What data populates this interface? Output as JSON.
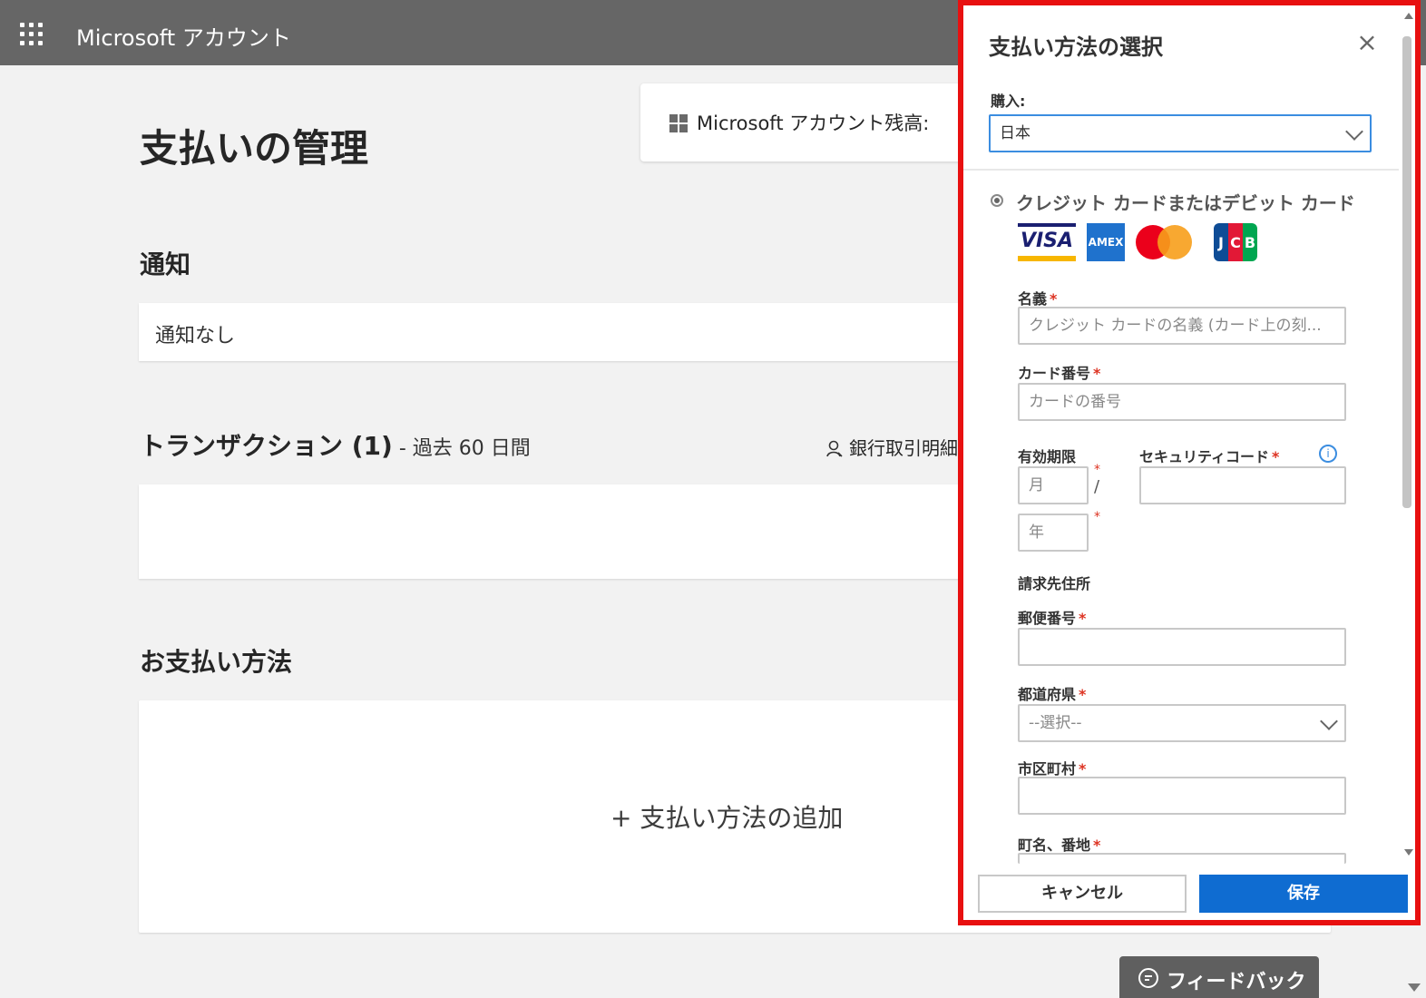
{
  "header": {
    "app_title": "Microsoft アカウント"
  },
  "balance": {
    "label": "Microsoft アカウント残高:"
  },
  "page": {
    "title": "支払いの管理"
  },
  "notifications": {
    "heading": "通知",
    "empty_text": "通知なし"
  },
  "transactions": {
    "heading": "トランザクション (1)",
    "subheading": " - 過去 60 日間",
    "bank_statement_link": "銀行取引明細"
  },
  "payment_methods": {
    "heading": "お支払い方法",
    "add_label": "+ 支払い方法の追加"
  },
  "feedback": {
    "label": "フィードバック"
  },
  "panel": {
    "title": "支払い方法の選択",
    "close_label": "×",
    "purchase_label": "購入:",
    "country_value": "日本",
    "card_type_label": "クレジット カードまたはデビット カード",
    "card_logos": {
      "visa": "VISA",
      "amex": "AMEX",
      "jcb": [
        "J",
        "C",
        "B"
      ]
    },
    "name_label": "名義",
    "name_placeholder": "クレジット カードの名義 (カード上の刻...",
    "card_number_label": "カード番号",
    "card_number_placeholder": "カードの番号",
    "expiry_label": "有効期限",
    "month_placeholder": "月",
    "year_placeholder": "年",
    "slash": "/",
    "security_code_label": "セキュリティコード",
    "billing_address_label": "請求先住所",
    "postal_code_label": "郵便番号",
    "prefecture_label": "都道府県",
    "prefecture_value": "--選択--",
    "city_label": "市区町村",
    "street_label": "町名、番地",
    "required_mark": "*",
    "cancel_label": "キャンセル",
    "save_label": "保存"
  },
  "colors": {
    "topbar": "#666666",
    "accent": "#0f6cd1",
    "highlight_border": "#e81010"
  }
}
